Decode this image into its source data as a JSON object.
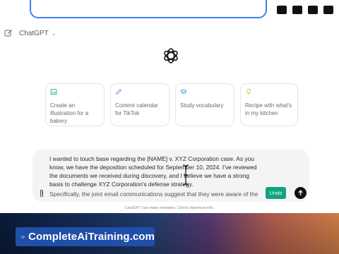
{
  "header": {
    "model_label": "ChatGPT"
  },
  "suggestions": [
    {
      "label": "Create an illustration for a bakery",
      "icon": "image-icon",
      "color": "#37b89a"
    },
    {
      "label": "Content calendar for TikTok",
      "icon": "pen-icon",
      "color": "#7aa0d8"
    },
    {
      "label": "Study vocabulary",
      "icon": "graduation-cap-icon",
      "color": "#58a6c9"
    },
    {
      "label": "Recipe with what's in my kitchen",
      "icon": "lightbulb-icon",
      "color": "#d8c23a"
    }
  ],
  "composer": {
    "paragraph_1": "I wanted to touch base regarding the [NAME] v. XYZ Corporation case. As you know, we have the deposition scheduled for September 10, 2024. I've reviewed the documents we received during discovery, and I believe we have a strong basis to challenge XYZ Corporation's defense strategy.",
    "paragraph_2_partial": "Specifically, the joint email communications suggest that they were aware of the",
    "undo_label": "Undo"
  },
  "disclaimer": "ChatGPT can make mistakes. Check important info.",
  "banner": {
    "brand_text": "CompleteAiTraining.com"
  },
  "colors": {
    "accent_green": "#10a37f",
    "brand_blue": "#1f4fa8",
    "url_outline": "#3b82f6"
  }
}
